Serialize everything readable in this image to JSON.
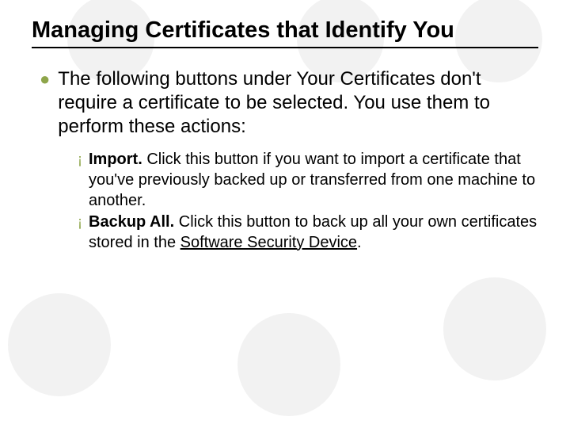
{
  "title": "Managing Certificates that Identify You",
  "body": {
    "intro": "The following buttons under Your Certificates don't require a certificate to be selected. You use them to perform these actions:",
    "items": [
      {
        "label": "Import.",
        "desc": " Click this button if you want to import a certificate that you've previously backed up or transferred from one machine to another."
      },
      {
        "label": "Backup All.",
        "desc_before": " Click this button to back up all your own certificates stored in the ",
        "link": "Software Security Device",
        "desc_after": "."
      }
    ]
  },
  "bullets": {
    "level1": "●",
    "level2": "¡"
  }
}
